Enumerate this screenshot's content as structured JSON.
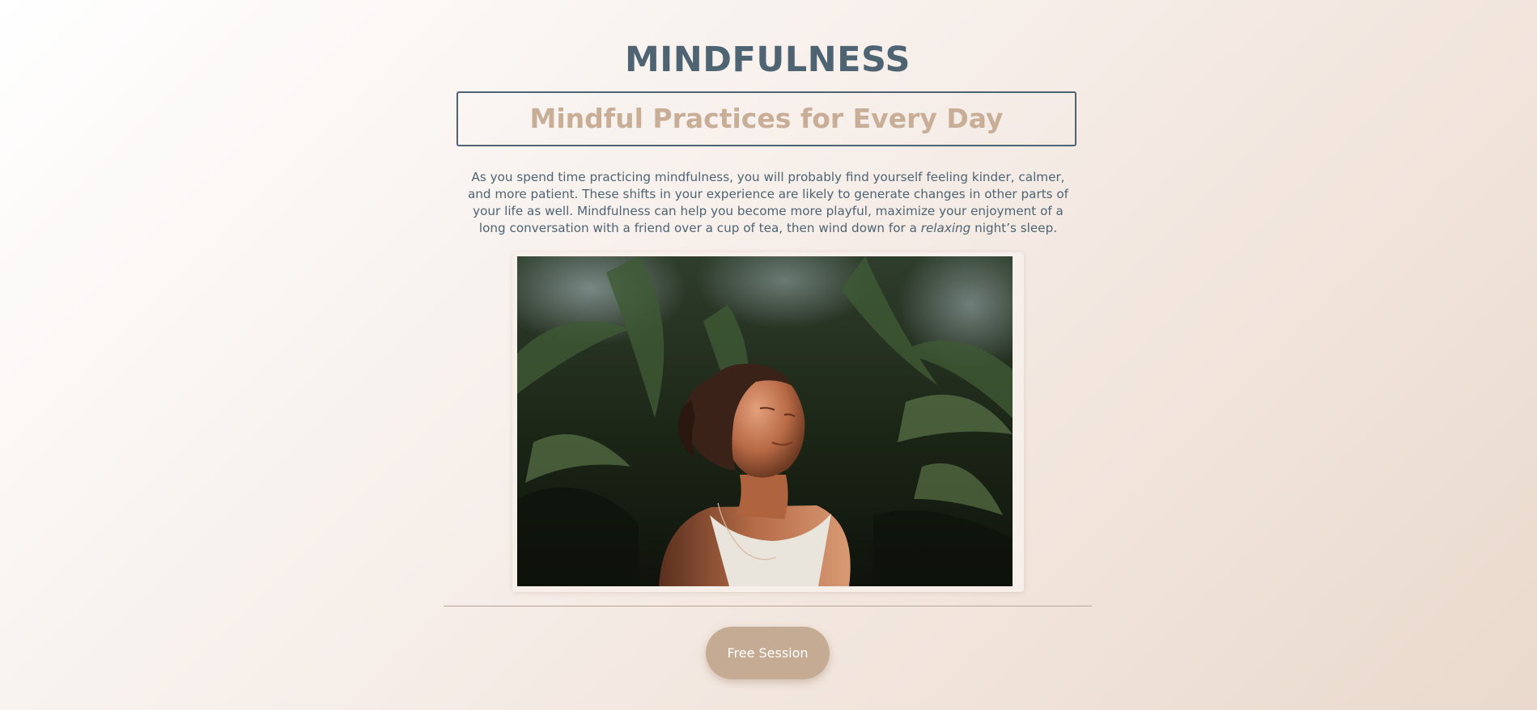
{
  "header": {
    "title": "MINDFULNESS",
    "subtitle": "Mindful Practices for Every Day"
  },
  "intro": {
    "text_before": "As you spend time practicing mindfulness, you will probably find yourself feeling kinder, calmer, and more patient. These shifts in your experience are likely to generate changes in other parts of your life as well. Mindfulness can help you become more playful, maximize your enjoyment of a long conversation with a friend over a cup of tea, then wind down for a ",
    "emphasis": "relaxing",
    "text_after": " night’s sleep."
  },
  "cta": {
    "label": "Free Session"
  },
  "colors": {
    "primary": "#4f6473",
    "accent": "#c8ad97",
    "button": "#c6ab94"
  }
}
